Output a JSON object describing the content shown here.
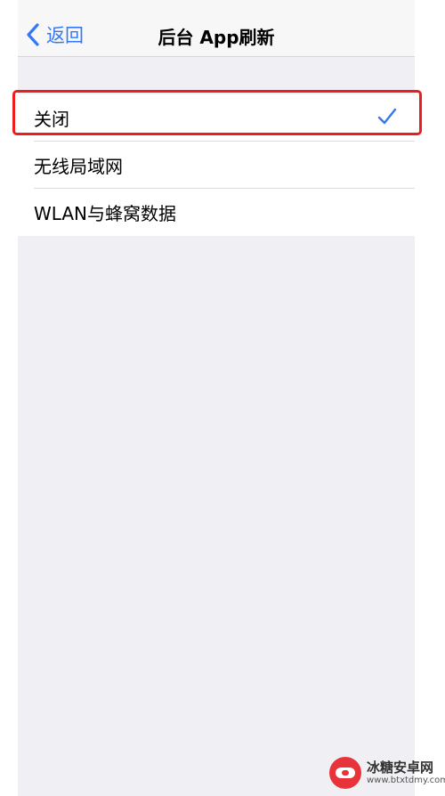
{
  "navbar": {
    "back_label": "返回",
    "title": "后台 App刷新"
  },
  "options": [
    {
      "label": "关闭",
      "selected": true
    },
    {
      "label": "无线局域网",
      "selected": false
    },
    {
      "label": "WLAN与蜂窝数据",
      "selected": false
    }
  ],
  "colors": {
    "accent": "#3478f6",
    "highlight": "#ee1d1d",
    "background": "#efeff4"
  },
  "watermark": {
    "name": "冰糖安卓网",
    "url": "www.btxtdmy.com"
  }
}
